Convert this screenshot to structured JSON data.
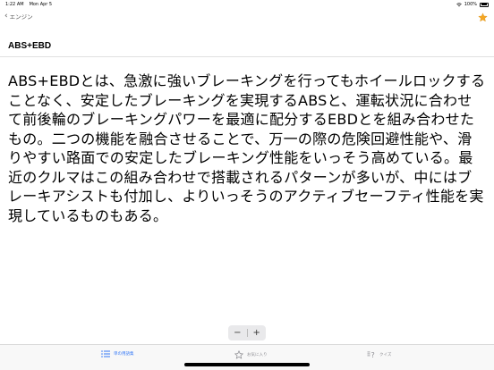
{
  "status_bar": {
    "time": "1:22 AM",
    "date": "Mon Apr 5",
    "battery": "100%",
    "icons": [
      "wifi-icon",
      "battery-icon"
    ]
  },
  "nav": {
    "back_label": "エンジン",
    "back_icon": "chevron-left-icon",
    "favorite_icon": "star-icon",
    "accent_color": "#f5a623"
  },
  "page": {
    "title": "ABS+EBD",
    "body": "ABS+EBDとは、急激に強いブレーキングを行ってもホイールロックすることなく、安定したブレーキングを実現するABSと、運転状況に合わせて前後輪のブレーキングパワーを最適に配分するEBDとを組み合わせたもの。二つの機能を融合させることで、万一の際の危険回避性能や、滑りやすい路面での安定したブレーキング性能をいっそう高めている。最近のクルマはこの組み合わせで搭載されるパターンが多いが、中にはブレーキアシストも付加し、よりいっそうのアクティブセーフティ性能を実現しているものもある。"
  },
  "font_stepper": {
    "decrease_label": "−",
    "increase_label": "+"
  },
  "tab_bar": {
    "tabs": [
      {
        "label": "単の用語集",
        "icon": "list-icon",
        "active": true
      },
      {
        "label": "お気に入り",
        "icon": "star-outline-icon",
        "active": false
      },
      {
        "label": "クイズ",
        "icon": "quiz-icon",
        "active": false
      }
    ],
    "active_color": "#3478f6",
    "inactive_color": "#8e8e93"
  }
}
